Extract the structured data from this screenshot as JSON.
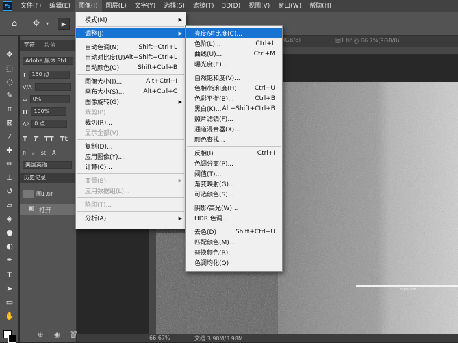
{
  "menubar": {
    "logo": "Ps",
    "items": [
      "文件(F)",
      "编辑(E)",
      "图像(I)",
      "图层(L)",
      "文字(Y)",
      "选择(S)",
      "滤镜(T)",
      "3D(D)",
      "视图(V)",
      "窗口(W)",
      "帮助(H)"
    ],
    "active_index": 2
  },
  "options": {
    "doc_tab_1": "…(RGB/8)",
    "doc_tab_2": "图1.tif @ 66.7%(RGB/8)",
    "panel_tab_char": "字符",
    "panel_tab_para": "段落"
  },
  "character_panel": {
    "font": "Adobe 黑体 Std",
    "size": "150 点",
    "tracking": "0%",
    "scale": "100%",
    "baseline": "0 点",
    "language": "美国英语",
    "history_tab": "历史记录",
    "history_doc": "图1.tif",
    "history_step": "打开"
  },
  "status": {
    "zoom": "66.67%",
    "doc_info": "文档:3.98M/3.98M"
  },
  "scalebar_label": "5000 nm",
  "image_menu": [
    {
      "label": "模式(M)",
      "shortcut": "",
      "submenu": true,
      "disabled": false
    },
    {
      "sep": true
    },
    {
      "label": "调整(J)",
      "shortcut": "",
      "submenu": true,
      "disabled": false,
      "highlight": true
    },
    {
      "sep": true
    },
    {
      "label": "自动色调(N)",
      "shortcut": "Shift+Ctrl+L",
      "disabled": false
    },
    {
      "label": "自动对比度(U)",
      "shortcut": "Alt+Shift+Ctrl+L",
      "disabled": false
    },
    {
      "label": "自动颜色(O)",
      "shortcut": "Shift+Ctrl+B",
      "disabled": false
    },
    {
      "sep": true
    },
    {
      "label": "图像大小(I)...",
      "shortcut": "Alt+Ctrl+I",
      "disabled": false
    },
    {
      "label": "画布大小(S)...",
      "shortcut": "Alt+Ctrl+C",
      "disabled": false
    },
    {
      "label": "图像旋转(G)",
      "shortcut": "",
      "submenu": true,
      "disabled": false
    },
    {
      "label": "裁剪(P)",
      "shortcut": "",
      "disabled": true
    },
    {
      "label": "裁切(R)...",
      "shortcut": "",
      "disabled": false
    },
    {
      "label": "显示全部(V)",
      "shortcut": "",
      "disabled": true
    },
    {
      "sep": true
    },
    {
      "label": "复制(D)...",
      "shortcut": "",
      "disabled": false
    },
    {
      "label": "应用图像(Y)...",
      "shortcut": "",
      "disabled": false
    },
    {
      "label": "计算(C)...",
      "shortcut": "",
      "disabled": false
    },
    {
      "sep": true
    },
    {
      "label": "变量(B)",
      "shortcut": "",
      "submenu": true,
      "disabled": true
    },
    {
      "label": "应用数据组(L)...",
      "shortcut": "",
      "disabled": true
    },
    {
      "sep": true
    },
    {
      "label": "陷印(T)...",
      "shortcut": "",
      "disabled": true
    },
    {
      "sep": true
    },
    {
      "label": "分析(A)",
      "shortcut": "",
      "submenu": true,
      "disabled": false
    }
  ],
  "adjust_menu": [
    {
      "label": "亮度/对比度(C)...",
      "shortcut": "",
      "highlight": true
    },
    {
      "label": "色阶(L)...",
      "shortcut": "Ctrl+L"
    },
    {
      "label": "曲线(U)...",
      "shortcut": "Ctrl+M"
    },
    {
      "label": "曝光度(E)...",
      "shortcut": ""
    },
    {
      "sep": true
    },
    {
      "label": "自然饱和度(V)...",
      "shortcut": ""
    },
    {
      "label": "色相/饱和度(H)...",
      "shortcut": "Ctrl+U"
    },
    {
      "label": "色彩平衡(B)...",
      "shortcut": "Ctrl+B"
    },
    {
      "label": "黑白(K)...",
      "shortcut": "Alt+Shift+Ctrl+B"
    },
    {
      "label": "照片滤镜(F)...",
      "shortcut": ""
    },
    {
      "label": "通道混合器(X)...",
      "shortcut": ""
    },
    {
      "label": "颜色查找...",
      "shortcut": ""
    },
    {
      "sep": true
    },
    {
      "label": "反相(I)",
      "shortcut": "Ctrl+I"
    },
    {
      "label": "色调分离(P)...",
      "shortcut": ""
    },
    {
      "label": "阈值(T)...",
      "shortcut": ""
    },
    {
      "label": "渐变映射(G)...",
      "shortcut": ""
    },
    {
      "label": "可选颜色(S)...",
      "shortcut": ""
    },
    {
      "sep": true
    },
    {
      "label": "阴影/高光(W)...",
      "shortcut": ""
    },
    {
      "label": "HDR 色调...",
      "shortcut": ""
    },
    {
      "sep": true
    },
    {
      "label": "去色(D)",
      "shortcut": "Shift+Ctrl+U"
    },
    {
      "label": "匹配颜色(M)...",
      "shortcut": ""
    },
    {
      "label": "替换颜色(R)...",
      "shortcut": ""
    },
    {
      "label": "色调均化(Q)",
      "shortcut": ""
    }
  ],
  "colors": {
    "highlight": "#1874d2",
    "menu_bg": "#f0f0f0",
    "ui_dark": "#535353"
  }
}
